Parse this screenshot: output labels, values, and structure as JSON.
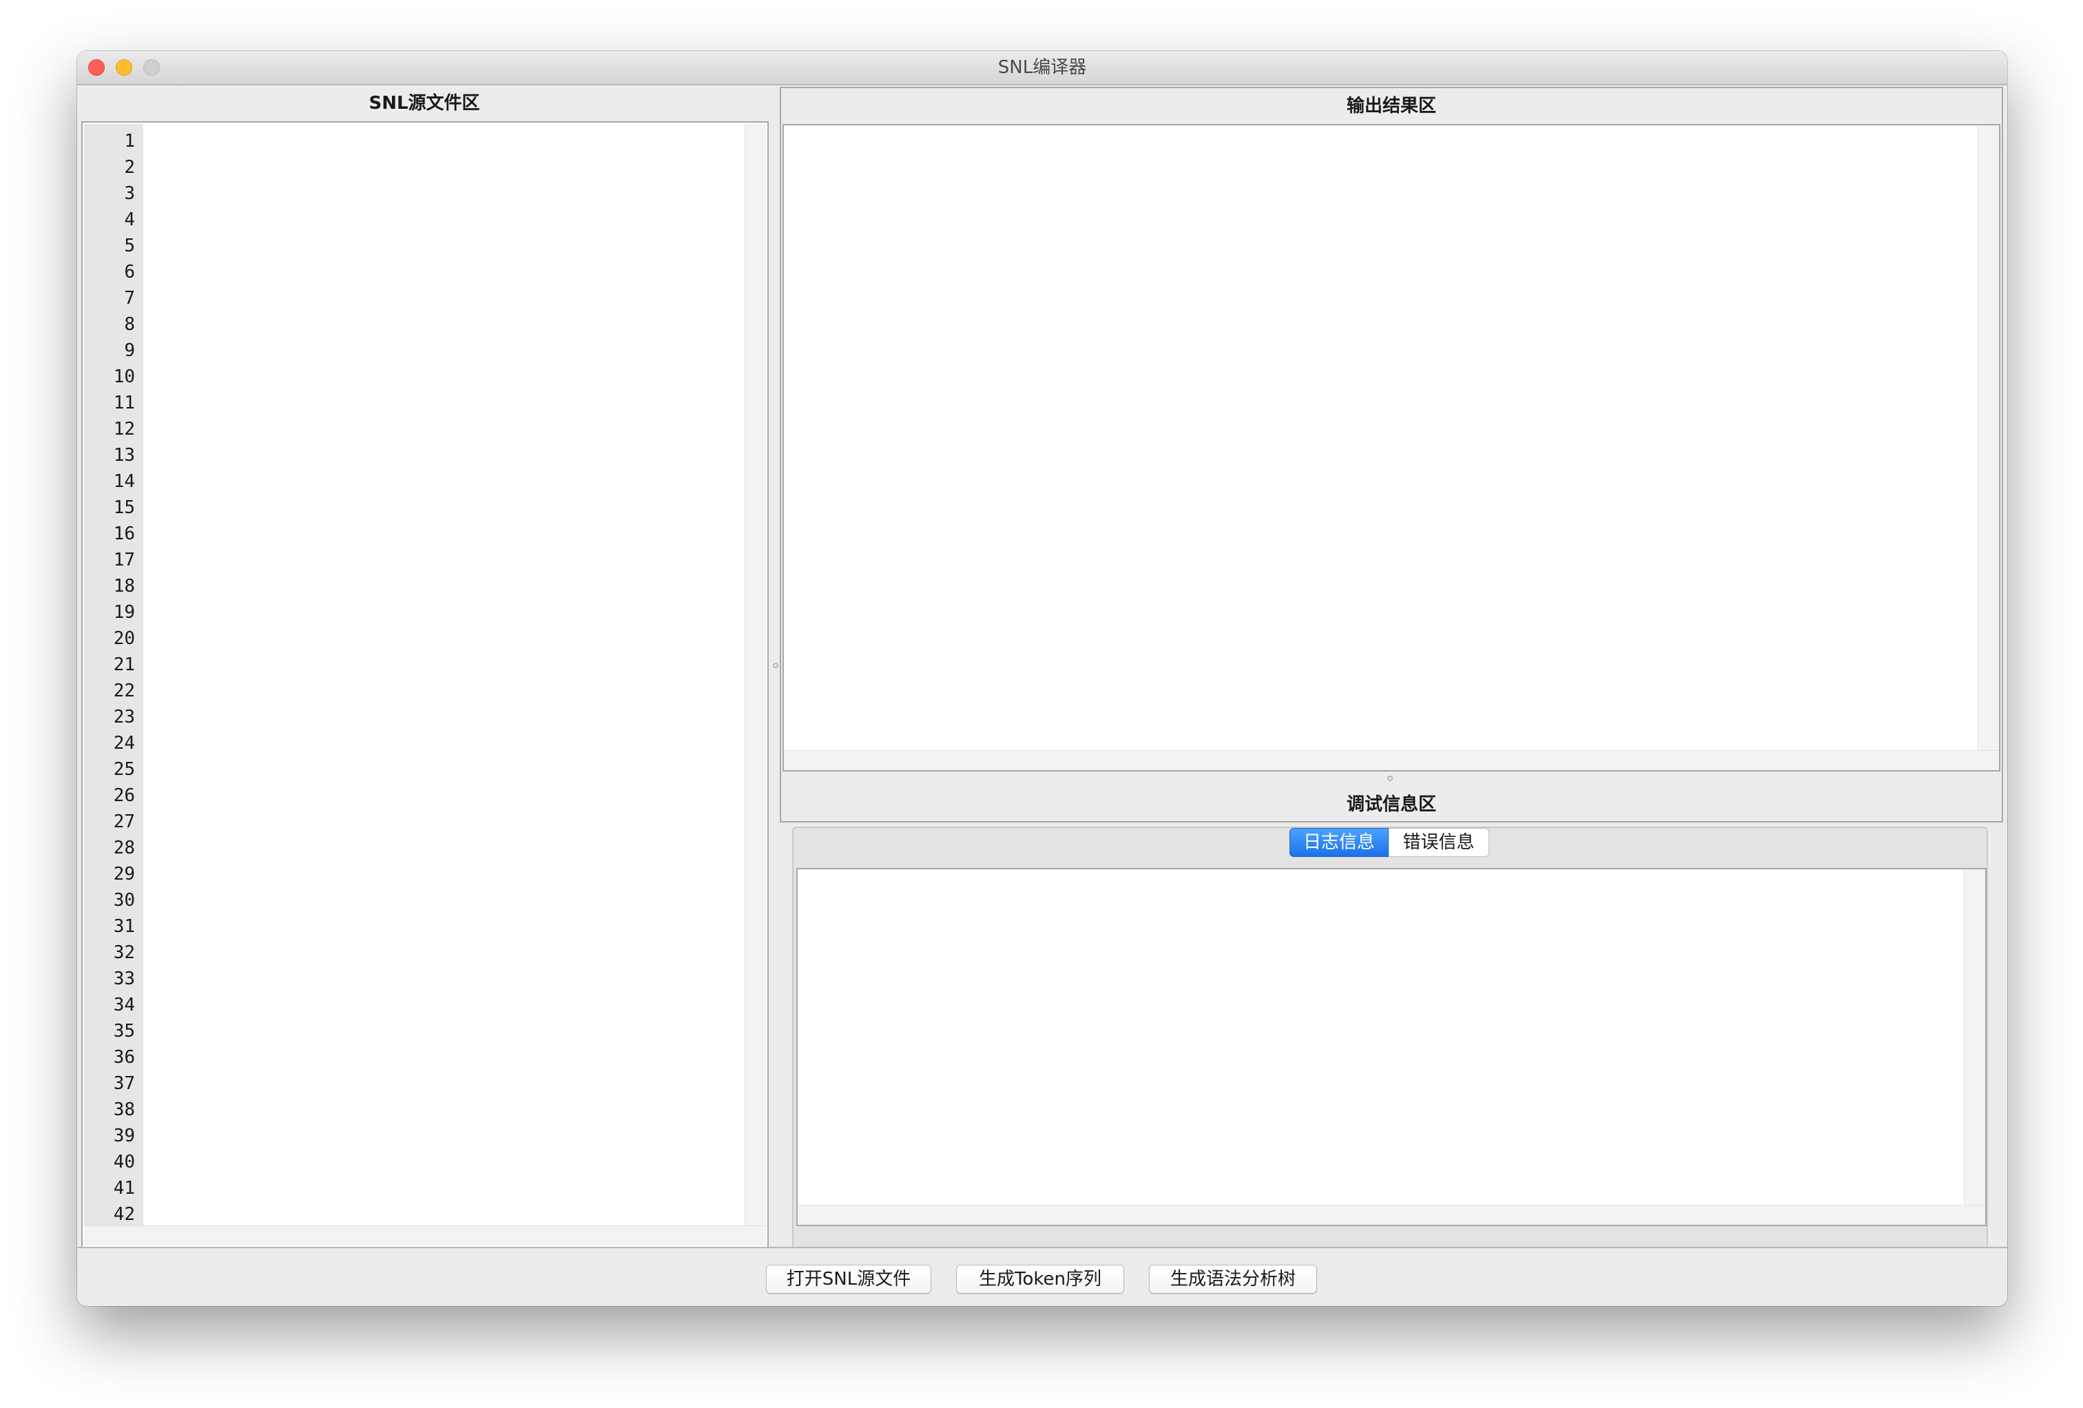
{
  "window": {
    "title": "SNL编译器"
  },
  "source_panel": {
    "title": "SNL源文件区",
    "line_numbers": [
      "1",
      "2",
      "3",
      "4",
      "5",
      "6",
      "7",
      "8",
      "9",
      "10",
      "11",
      "12",
      "13",
      "14",
      "15",
      "16",
      "17",
      "18",
      "19",
      "20",
      "21",
      "22",
      "23",
      "24",
      "25",
      "26",
      "27",
      "28",
      "29",
      "30",
      "31",
      "32",
      "33",
      "34",
      "35",
      "36",
      "37",
      "38",
      "39",
      "40",
      "41",
      "42"
    ]
  },
  "output_panel": {
    "title": "输出结果区"
  },
  "debug_panel": {
    "title": "调试信息区",
    "tabs": [
      {
        "label": "日志信息",
        "active": true
      },
      {
        "label": "错误信息",
        "active": false
      }
    ]
  },
  "buttons": {
    "open_file": "打开SNL源文件",
    "gen_tokens": "生成Token序列",
    "gen_tree": "生成语法分析树"
  },
  "colors": {
    "accent": "#1a73e8",
    "close": "#fe5f57",
    "minimize": "#febc2e"
  }
}
